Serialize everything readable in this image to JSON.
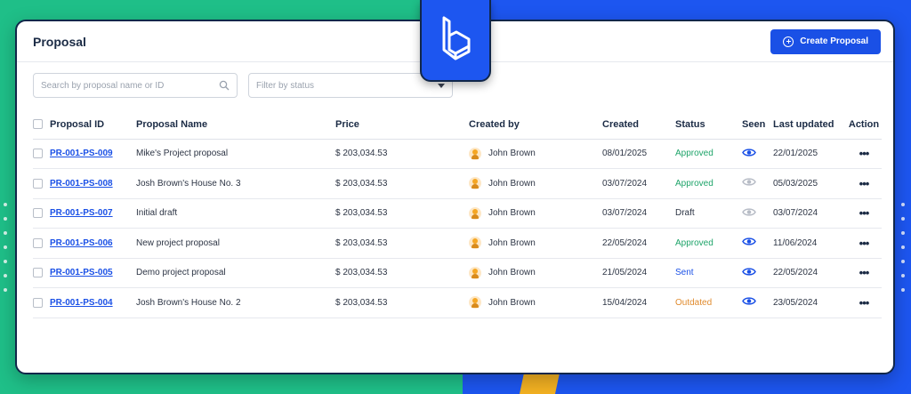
{
  "header": {
    "title": "Proposal",
    "create_label": "Create Proposal"
  },
  "filters": {
    "search_placeholder": "Search by proposal name or ID",
    "status_placeholder": "Filter by status"
  },
  "table": {
    "columns": [
      "Proposal ID",
      "Proposal Name",
      "Price",
      "Created by",
      "Created",
      "Status",
      "Seen",
      "Last updated",
      "Action"
    ],
    "rows": [
      {
        "id": "PR-001-PS-009",
        "name": "Mike's Project proposal",
        "price": "$ 203,034.53",
        "created_by": "John Brown",
        "created": "08/01/2025",
        "status": "Approved",
        "seen": true,
        "last_updated": "22/01/2025"
      },
      {
        "id": "PR-001-PS-008",
        "name": "Josh Brown's House No. 3",
        "price": "$ 203,034.53",
        "created_by": "John Brown",
        "created": "03/07/2024",
        "status": "Approved",
        "seen": false,
        "last_updated": "05/03/2025"
      },
      {
        "id": "PR-001-PS-007",
        "name": "Initial draft",
        "price": "$ 203,034.53",
        "created_by": "John Brown",
        "created": "03/07/2024",
        "status": "Draft",
        "seen": false,
        "last_updated": "03/07/2024"
      },
      {
        "id": "PR-001-PS-006",
        "name": "New project proposal",
        "price": "$ 203,034.53",
        "created_by": "John Brown",
        "created": "22/05/2024",
        "status": "Approved",
        "seen": true,
        "last_updated": "11/06/2024"
      },
      {
        "id": "PR-001-PS-005",
        "name": "Demo project proposal",
        "price": "$ 203,034.53",
        "created_by": "John Brown",
        "created": "21/05/2024",
        "status": "Sent",
        "seen": true,
        "last_updated": "22/05/2024"
      },
      {
        "id": "PR-001-PS-004",
        "name": "Josh Brown's House No. 2",
        "price": "$ 203,034.53",
        "created_by": "John Brown",
        "created": "15/04/2024",
        "status": "Outdated",
        "seen": true,
        "last_updated": "23/05/2024"
      }
    ]
  },
  "colors": {
    "accent": "#1a50e6",
    "approved": "#1fa46a",
    "sent": "#1a50e6",
    "outdated": "#e08b2e",
    "seen_active": "#1a50e6",
    "seen_inactive": "#b7bcc6"
  },
  "icons": {
    "logo": "building-block-logo-icon",
    "search": "search-icon",
    "create": "plus-circle-icon",
    "seen": "eye-icon",
    "action": "more-dots-icon",
    "avatar": "person-avatar-icon"
  }
}
